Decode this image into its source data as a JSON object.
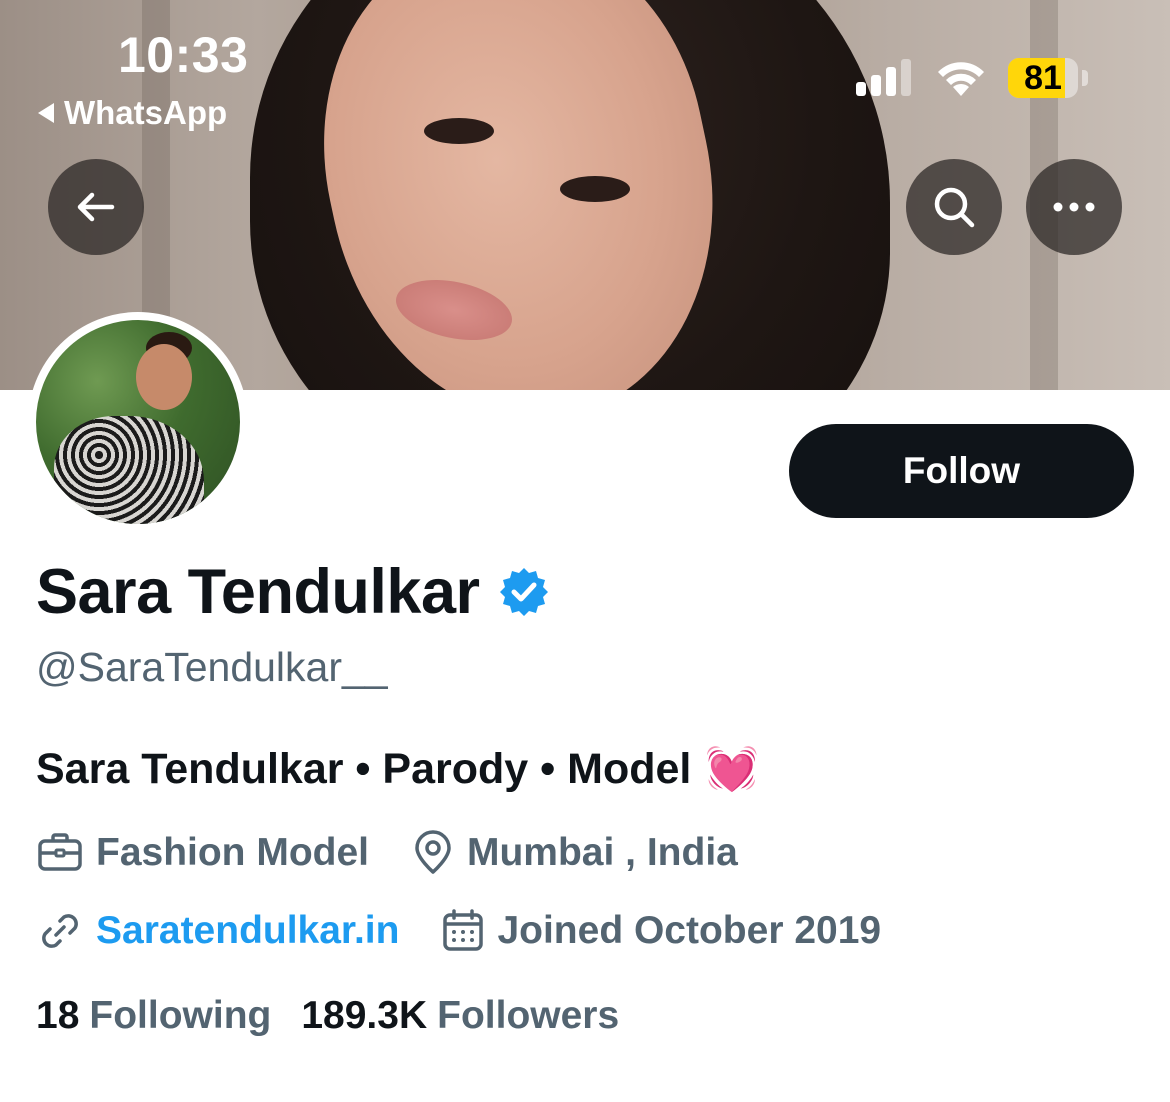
{
  "status_bar": {
    "time": "10:33",
    "back_app": "WhatsApp",
    "battery_level": "81",
    "battery_percent": 81,
    "battery_color": "#ffd60a"
  },
  "nav": {
    "back_icon": "arrow-left-icon",
    "search_icon": "search-icon",
    "more_icon": "more-horizontal-icon"
  },
  "profile": {
    "display_name": "Sara Tendulkar",
    "verified": true,
    "handle": "@SaraTendulkar__",
    "follow_label": "Follow",
    "bio": "Sara Tendulkar • Parody • Model",
    "bio_emoji": "💓",
    "category": "Fashion Model",
    "location": "Mumbai , India",
    "website": "Saratendulkar.in",
    "joined": "Joined October 2019",
    "following_count": "18",
    "following_label": "Following",
    "followers_count": "189.3K",
    "followers_label": "Followers"
  },
  "colors": {
    "text_primary": "#0f1419",
    "text_secondary": "#536471",
    "link": "#1d9bf0",
    "verified_badge": "#1d9bf0",
    "follow_button_bg": "#0f1419"
  }
}
